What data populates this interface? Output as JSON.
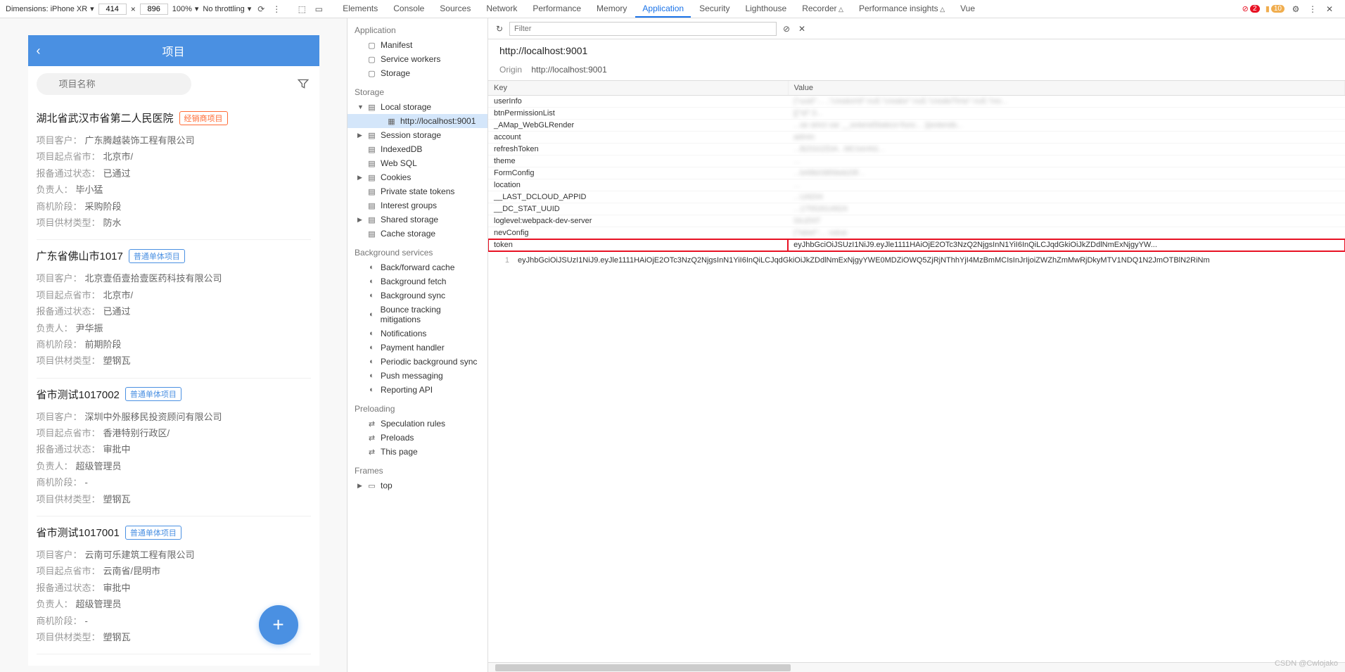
{
  "toolbar": {
    "dimensions_label": "Dimensions: iPhone XR",
    "width": "414",
    "height": "896",
    "zoom": "100%",
    "throttling": "No throttling"
  },
  "tabs": [
    "Elements",
    "Console",
    "Sources",
    "Network",
    "Performance",
    "Memory",
    "Application",
    "Security",
    "Lighthouse",
    "Recorder",
    "Performance insights",
    "Vue"
  ],
  "active_tab": "Application",
  "error_count": "2",
  "warn_count": "10",
  "mobile": {
    "title": "项目",
    "search_placeholder": "项目名称",
    "projects": [
      {
        "title": "湖北省武汉市省第二人民医院",
        "tag": "经销商项目",
        "tag_class": "tag-dealer",
        "fields": [
          {
            "label": "项目客户：",
            "value": "广东腾越装饰工程有限公司"
          },
          {
            "label": "项目起点省市：",
            "value": "北京市/"
          },
          {
            "label": "报备通过状态：",
            "value": "已通过"
          },
          {
            "label": "负责人：",
            "value": "毕小猛"
          },
          {
            "label": "商机阶段：",
            "value": "采购阶段"
          },
          {
            "label": "项目供材类型：",
            "value": "防水"
          }
        ]
      },
      {
        "title": "广东省佛山市1017",
        "tag": "普通单体项目",
        "tag_class": "tag-normal",
        "fields": [
          {
            "label": "项目客户：",
            "value": "北京壹佰壹拾壹医药科技有限公司"
          },
          {
            "label": "项目起点省市：",
            "value": "北京市/"
          },
          {
            "label": "报备通过状态：",
            "value": "已通过"
          },
          {
            "label": "负责人：",
            "value": "尹华振"
          },
          {
            "label": "商机阶段：",
            "value": "前期阶段"
          },
          {
            "label": "项目供材类型：",
            "value": "塑钢瓦"
          }
        ]
      },
      {
        "title": "省市测试1017002",
        "tag": "普通单体项目",
        "tag_class": "tag-normal",
        "fields": [
          {
            "label": "项目客户：",
            "value": "深圳中外服移民投资顾问有限公司"
          },
          {
            "label": "项目起点省市：",
            "value": "香港特别行政区/"
          },
          {
            "label": "报备通过状态：",
            "value": "审批中"
          },
          {
            "label": "负责人：",
            "value": "超级管理员"
          },
          {
            "label": "商机阶段：",
            "value": "-"
          },
          {
            "label": "项目供材类型：",
            "value": "塑钢瓦"
          }
        ]
      },
      {
        "title": "省市测试1017001",
        "tag": "普通单体项目",
        "tag_class": "tag-normal",
        "fields": [
          {
            "label": "项目客户：",
            "value": "云南可乐建筑工程有限公司"
          },
          {
            "label": "项目起点省市：",
            "value": "云南省/昆明市"
          },
          {
            "label": "报备通过状态：",
            "value": "审批中"
          },
          {
            "label": "负责人：",
            "value": "超级管理员"
          },
          {
            "label": "商机阶段：",
            "value": "-"
          },
          {
            "label": "项目供材类型：",
            "value": "塑钢瓦"
          }
        ]
      }
    ]
  },
  "tree": {
    "application": {
      "title": "Application",
      "items": [
        "Manifest",
        "Service workers",
        "Storage"
      ]
    },
    "storage": {
      "title": "Storage",
      "items": [
        {
          "label": "Local storage",
          "expandable": true,
          "expanded": true,
          "children": [
            {
              "label": "http://localhost:9001",
              "selected": true
            }
          ]
        },
        {
          "label": "Session storage",
          "expandable": true
        },
        {
          "label": "IndexedDB"
        },
        {
          "label": "Web SQL"
        },
        {
          "label": "Cookies",
          "expandable": true
        },
        {
          "label": "Private state tokens"
        },
        {
          "label": "Interest groups"
        },
        {
          "label": "Shared storage",
          "expandable": true
        },
        {
          "label": "Cache storage"
        }
      ]
    },
    "background": {
      "title": "Background services",
      "items": [
        "Back/forward cache",
        "Background fetch",
        "Background sync",
        "Bounce tracking mitigations",
        "Notifications",
        "Payment handler",
        "Periodic background sync",
        "Push messaging",
        "Reporting API"
      ]
    },
    "preloading": {
      "title": "Preloading",
      "items": [
        "Speculation rules",
        "Preloads",
        "This page"
      ]
    },
    "frames": {
      "title": "Frames",
      "items": [
        {
          "label": "top",
          "expandable": true
        }
      ]
    }
  },
  "content": {
    "filter_placeholder": "Filter",
    "url": "http://localhost:9001",
    "origin_label": "Origin",
    "origin_value": "http://localhost:9001",
    "headers": {
      "key": "Key",
      "value": "Value"
    },
    "rows": [
      {
        "key": "userInfo",
        "value": "{\"uuid\":... ,\"creatorId\":null,\"creator\":null,\"createTime\":null,\"mo...",
        "blurred": true
      },
      {
        "key": "btnPermissionList",
        "value": "[{\"id\":3...",
        "blurred": true
      },
      {
        "key": "_AMap_WebGLRender",
        "value": "...se strict var __extendStatics=func... ){extends...",
        "blurred": true
      },
      {
        "key": "account",
        "value": "admin",
        "blurred": true
      },
      {
        "key": "refreshToken",
        "value": "...BZGI2ZDA...MCIsInN1...",
        "blurred": true
      },
      {
        "key": "theme",
        "value": "...",
        "blurred": true
      },
      {
        "key": "FormConfig",
        "value": "...b49b03856eb29f...",
        "blurred": true
      },
      {
        "key": "location",
        "value": "...",
        "blurred": true
      },
      {
        "key": "__LAST_DCLOUD_APPID",
        "value": "...UADI4",
        "blurred": true
      },
      {
        "key": "__DC_STAT_UUID",
        "value": "...17552614924",
        "blurred": true
      },
      {
        "key": "loglevel:webpack-dev-server",
        "value": "SILENT",
        "blurred": true
      },
      {
        "key": "nevConfig",
        "value": "{\"label\":... value",
        "blurred": true
      },
      {
        "key": "token",
        "value": "eyJhbGciOiJSUzI1NiJ9.eyJle1111HAiOjE2OTc3NzQ2NjgsInN1YiI6InQiLCJqdGkiOiJkZDdlNmExNjgyYW...",
        "highlight": true
      }
    ],
    "selected_value_line": "1",
    "selected_value": "eyJhbGciOiJSUzI1NiJ9.eyJle1111HAiOjE2OTc3NzQ2NjgsInN1YiI6InQiLCJqdGkiOiJkZDdlNmExNjgyYWE0MDZiOWQ5ZjRjNThhYjI4MzBmMCIsInJrIjoiZWZhZmMwRjDkyMTV1NDQ1N2JmOTBlN2RiNm"
  },
  "watermark": "CSDN @Cwlojako"
}
